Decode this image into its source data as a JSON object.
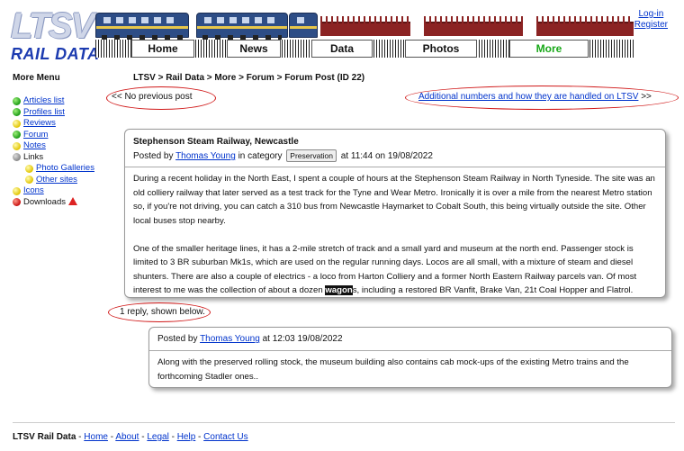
{
  "header": {
    "logo_text": "LTSV",
    "site_name": "RAIL DATA",
    "nav_tabs": [
      {
        "label": "Home",
        "active": false
      },
      {
        "label": "News",
        "active": false
      },
      {
        "label": "Data",
        "active": false
      },
      {
        "label": "Photos",
        "active": false
      },
      {
        "label": "More",
        "active": true
      }
    ],
    "login_label": "Log-in",
    "register_label": "Register",
    "colors": {
      "brand_blue": "#1c3bb0",
      "active_tab": "#18a818",
      "link": "#0033cc",
      "annotation_red": "#d01818"
    }
  },
  "sidebar": {
    "title": "More Menu",
    "items": [
      {
        "label": "Articles list",
        "link": true,
        "bullet": "green-dot-icon",
        "sub": false
      },
      {
        "label": "Profiles list",
        "link": true,
        "bullet": "green-dot-icon",
        "sub": false
      },
      {
        "label": "Reviews",
        "link": true,
        "bullet": "yellow-dot-icon",
        "sub": false
      },
      {
        "label": "Forum",
        "link": true,
        "bullet": "green-dot-icon",
        "sub": false
      },
      {
        "label": "Notes",
        "link": true,
        "bullet": "yellow-dot-icon",
        "sub": false
      },
      {
        "label": "Links",
        "link": false,
        "bullet": "grey-dot-icon",
        "sub": false
      },
      {
        "label": "Photo Galleries",
        "link": true,
        "bullet": "yellow-dot-icon",
        "sub": true
      },
      {
        "label": "Other sites",
        "link": true,
        "bullet": "yellow-dot-icon",
        "sub": true
      },
      {
        "label": "Icons",
        "link": true,
        "bullet": "yellow-dot-icon",
        "sub": false
      },
      {
        "label": "Downloads",
        "link": false,
        "bullet": "red-dot-icon",
        "sub": false,
        "warning": true
      }
    ]
  },
  "main": {
    "breadcrumb": "LTSV > Rail Data > More > Forum > Forum Post (ID 22)",
    "prev_post": "<< No previous post",
    "next_post_link": "Additional numbers and how they are handled on LTSV",
    "next_post_arrow": " >>",
    "post": {
      "title": "Stephenson Steam Railway, Newcastle",
      "posted_by_prefix": "Posted by ",
      "author": "Thomas Young",
      "category_prefix": " in category ",
      "category": "Preservation",
      "timestamp": "at 11:44 on 19/08/2022",
      "paragraph_1": "During a recent holiday in the North East, I spent a couple of hours at the Stephenson Steam Railway in North Tyneside. The site was an old colliery railway that later served as a test track for the Tyne and Wear Metro. Ironically it is over a mile from the nearest Metro station so, if you're not driving, you can catch a 310 bus from Newcastle Haymarket to Cobalt South, this being virtually outside the site. Other local buses stop nearby.",
      "paragraph_2_before": "One of the smaller heritage lines, it has a 2-mile stretch of track and a small yard and museum at the north end. Passenger stock is limited to 3 BR suburban Mk1s, which are used on the regular running days. Locos are all small, with a mixture of steam and diesel shunters. There are also a couple of electrics - a loco from Harton Colliery and a former North Eastern Railway parcels van. Of most interest to me was the collection of about a dozen ",
      "paragraph_2_highlight": "wagon",
      "paragraph_2_after": "s, including a restored BR Vanfit, Brake Van, 21t Coal Hopper and Flatrol."
    },
    "reply_count": "1 reply, shown below.",
    "reply": {
      "posted_by_prefix": "Posted by ",
      "author": "Thomas Young",
      "timestamp": " at 12:03 19/08/2022",
      "body": "Along with the preserved rolling stock, the museum building also contains cab mock-ups of the existing Metro trains and the forthcoming Stadler ones.."
    }
  },
  "footer": {
    "site_label": "LTSV Rail Data",
    "separator": " - ",
    "links": [
      "Home",
      "About",
      "Legal",
      "Help",
      "Contact Us"
    ]
  }
}
